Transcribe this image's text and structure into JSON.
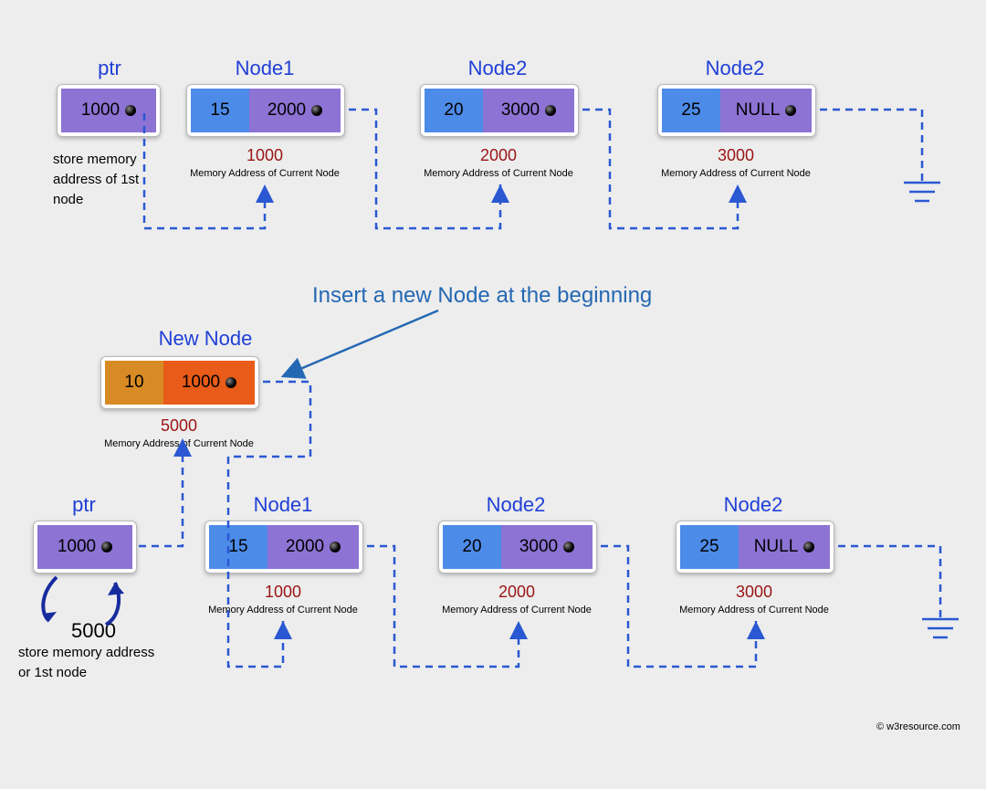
{
  "colors": {
    "label_blue": "#1f3fd6",
    "address_red": "#9b1414",
    "action_blue": "#2468b3",
    "arrow_blue": "#2a58d2",
    "cell_blue": "#4d8be8",
    "cell_purple": "#8d73d4",
    "cell_orange_data": "#d88a24",
    "cell_orange_next": "#e85b18"
  },
  "section1": {
    "ptr": {
      "label": "ptr",
      "value": "1000",
      "caption": "store memory\naddress of 1st\nnode"
    },
    "nodes": [
      {
        "label": "Node1",
        "data": "15",
        "next": "2000",
        "address": "1000",
        "note": "Memory Address of Current Node"
      },
      {
        "label": "Node2",
        "data": "20",
        "next": "3000",
        "address": "2000",
        "note": "Memory Address of Current Node"
      },
      {
        "label": "Node2",
        "data": "25",
        "next": "NULL",
        "address": "3000",
        "note": "Memory Address of Current Node"
      }
    ]
  },
  "action_title": "Insert a new Node at the beginning",
  "new_node": {
    "label": "New Node",
    "data": "10",
    "next": "1000",
    "address": "5000",
    "note": "Memory Address of Current Node"
  },
  "section2": {
    "ptr": {
      "label": "ptr",
      "value": "1000",
      "update_value": "5000",
      "caption": "store memory address\nor 1st node"
    },
    "nodes": [
      {
        "label": "Node1",
        "data": "15",
        "next": "2000",
        "address": "1000",
        "note": "Memory Address of Current Node"
      },
      {
        "label": "Node2",
        "data": "20",
        "next": "3000",
        "address": "2000",
        "note": "Memory Address of Current Node"
      },
      {
        "label": "Node2",
        "data": "25",
        "next": "NULL",
        "address": "3000",
        "note": "Memory Address of Current Node"
      }
    ]
  },
  "copyright": "© w3resource.com"
}
